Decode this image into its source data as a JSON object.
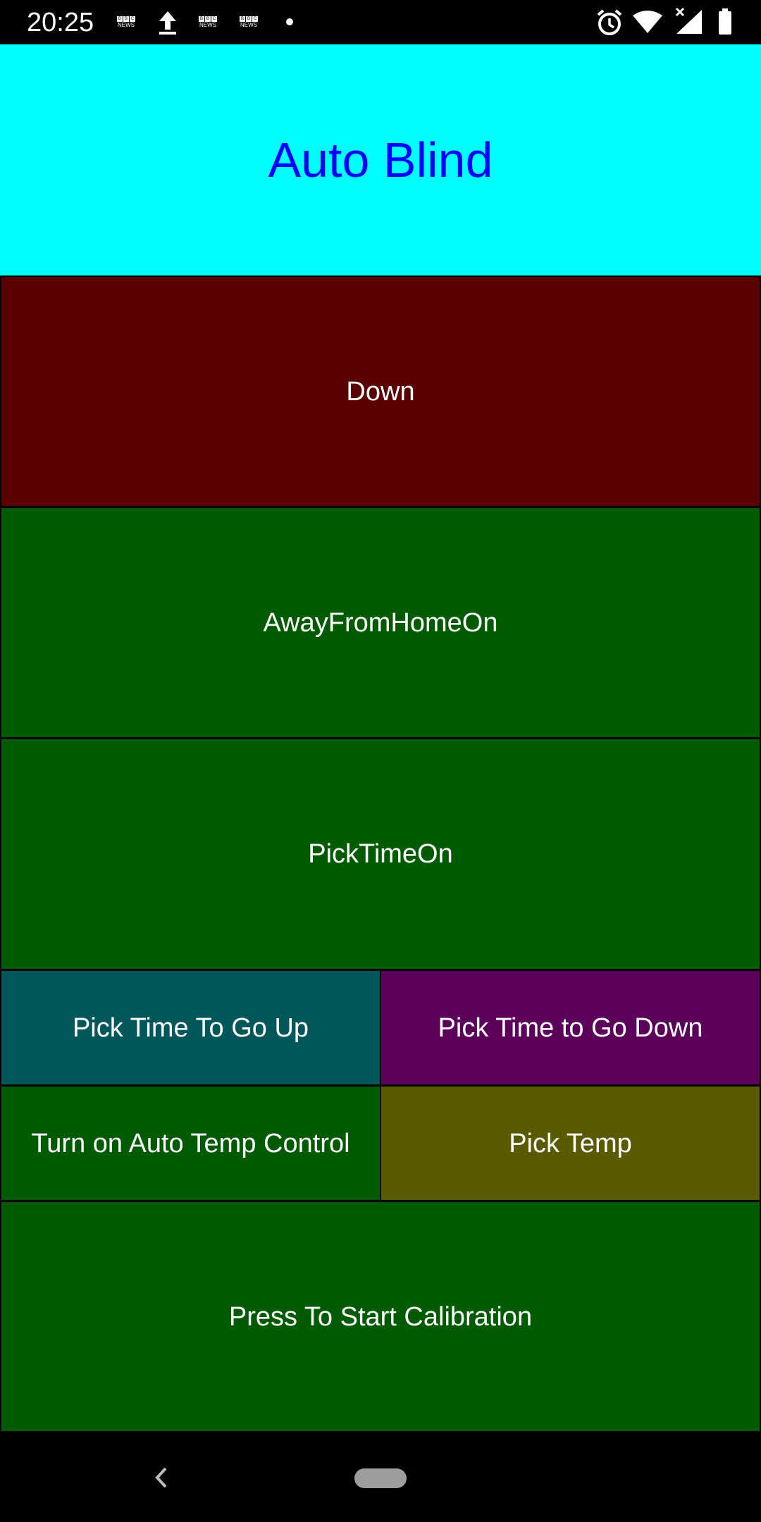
{
  "status_bar": {
    "time": "20:25",
    "notification_icons": [
      "bbc-news-icon",
      "upload-icon",
      "bbc-news-icon",
      "bbc-news-icon",
      "dot-icon"
    ],
    "bbc_text": "NEWS",
    "right_icons": [
      "alarm-icon",
      "wifi-icon",
      "signal-icon",
      "battery-icon"
    ]
  },
  "header": {
    "title": "Auto Blind",
    "background": "#00ffff",
    "title_color": "#0000ff"
  },
  "buttons": {
    "down": {
      "label": "Down",
      "color": "#5a0000"
    },
    "away_from_home": {
      "label": "AwayFromHomeOn",
      "color": "#005a00"
    },
    "pick_time_on": {
      "label": "PickTimeOn",
      "color": "#005a00"
    },
    "pick_time_up": {
      "label": "Pick Time To Go Up",
      "color": "#00575a"
    },
    "pick_time_down": {
      "label": "Pick Time to Go Down",
      "color": "#5a005a"
    },
    "auto_temp": {
      "label": "Turn on Auto Temp Control",
      "color": "#005a00"
    },
    "pick_temp": {
      "label": "Pick Temp",
      "color": "#5a5a00"
    },
    "calibration": {
      "label": "Press To Start Calibration",
      "color": "#005a00"
    }
  },
  "nav_bar": {
    "icons": [
      "back-icon",
      "home-pill"
    ]
  }
}
